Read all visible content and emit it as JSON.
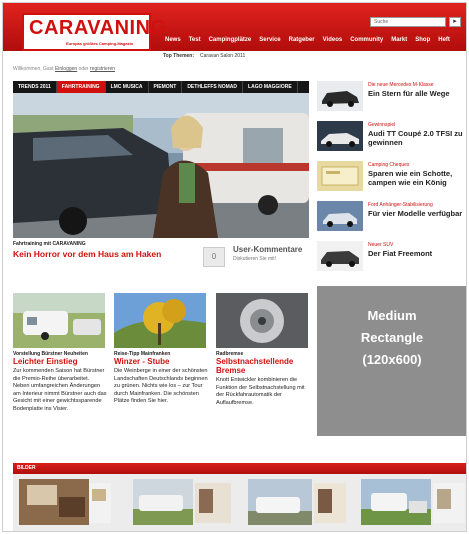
{
  "header": {
    "logo_text": "CARAVANING",
    "logo_sub": "Europas größtes Camping-Magazin",
    "search_placeholder": "Suche",
    "search_button": "▸",
    "nav": [
      "News",
      "Test",
      "Campingplätze",
      "Service",
      "Ratgeber",
      "Videos",
      "Community",
      "Markt",
      "Shop",
      "Heft"
    ],
    "top_topics_label": "Top Themen:",
    "top_topics_value": "Caravan Salon 2011"
  },
  "login": {
    "text_before": "Willkommen, Gast",
    "link1": "Einloggen",
    "text_mid": "oder",
    "link2": "registrieren"
  },
  "hero": {
    "tabs": [
      "TRENDS 2011",
      "FAHRTRAINING",
      "LMC MUSICA",
      "PIEMONT",
      "DETHLEFFS NOMAD",
      "LAGO MAGGIORE"
    ],
    "active_tab": 1,
    "caption": "Fahrtraining mit CARAVANING",
    "headline": "Kein Horror vor dem Haus am Haken",
    "comment_count": "0",
    "comment_title": "User-Kommentare",
    "comment_sub": "Diskutieren Sie mit!"
  },
  "right_list": [
    {
      "tag": "Die neue Mercedes M-Klasse",
      "title": "Ein Stern für alle Wege"
    },
    {
      "tag": "Gewinnspiel",
      "title": "Audi TT Coupé 2.0 TFSI zu gewinnen"
    },
    {
      "tag": "Camping Cheques",
      "title": "Sparen wie ein Schotte, campen wie ein König"
    },
    {
      "tag": "Ford Anhänger-Stabilisierung",
      "title": "Für vier Modelle verfügbar"
    },
    {
      "tag": "Neuer SUV",
      "title": "Der Fiat Freemont"
    }
  ],
  "articles": [
    {
      "caption": "Vorstellung Bürstner Neuheiten",
      "headline": "Leichter Einstieg",
      "body": "Zur kommenden Saison hat Bürstner die Premio-Reihe überarbeitet. Neben umfangreichen Änderungen am Interieur nimmt Bürstner auch das Gesicht mit einer gewichtssparende Bodenplatte ins Visier."
    },
    {
      "caption": "Reise-Tipp Mainfranken",
      "headline": "Winzer - Stube",
      "body": "Die Weinberge in einer der schönsten Landschaften Deutschlands beginnen zu grünen. Nichts wie los – zur Tour durch Mainfranken. Die schönsten Plätze finden Sie hier."
    },
    {
      "caption": "Radbremse",
      "headline": "Selbstnachstellende Bremse",
      "body": "Knott Entwickler kombinieren die Funktion der Selbstnachstellung mit der Rückfahrautomatik der Auflaufbremse."
    }
  ],
  "ad": {
    "line1": "Medium",
    "line2": "Rectangle",
    "line3": "(120x600)"
  },
  "bilder": {
    "label": "BILDER"
  },
  "colors": {
    "brand_red": "#d0100e",
    "ad_gray": "#8e8e8e"
  }
}
